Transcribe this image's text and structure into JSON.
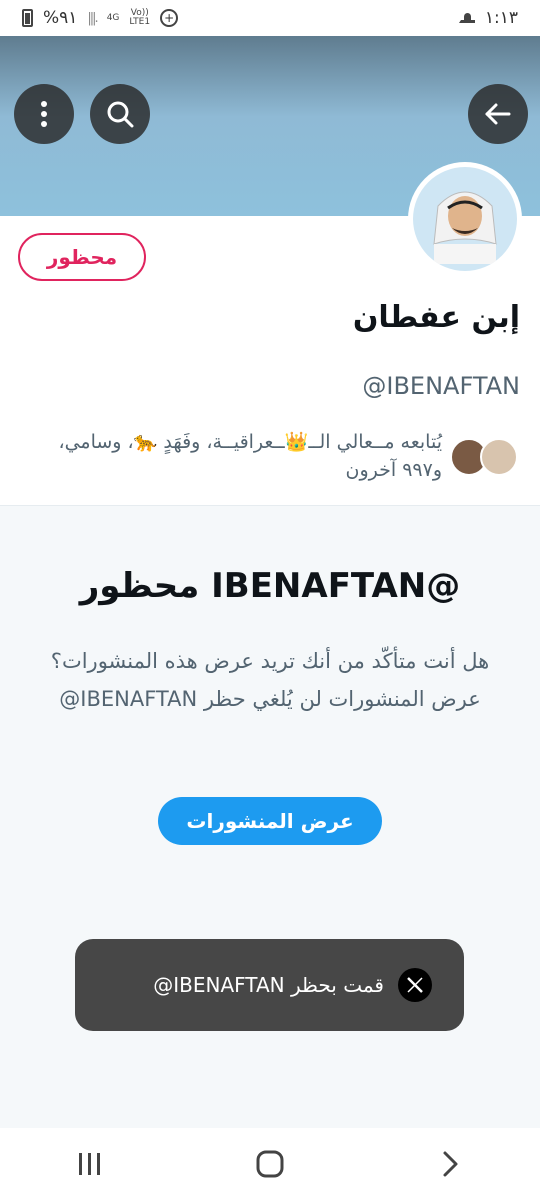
{
  "status_bar": {
    "battery_percent": "%٩١",
    "network_4g": "4G",
    "volte": "Vo))",
    "lte": "LTE1",
    "time": "١:١٣",
    "battery-icon": "battery-icon",
    "signal-icon": "signal-icon",
    "sync-icon": "plus-circle-icon"
  },
  "header": {
    "more_icon": "more-vertical-icon",
    "search_icon": "search-icon",
    "back_icon": "arrow-back-icon"
  },
  "profile": {
    "blocked_label": "محظور",
    "display_name": "إبن عفطان",
    "handle": "@IBENAFTAN",
    "followers_text": "يُتابعه مــعالي الــ👑ــعراقيــة، وفَهَدٍ 🐆، وسامي، و٩٩٧ آخرون"
  },
  "blocked_section": {
    "title": "@IBENAFTAN محظور",
    "description": "هل أنت متأكّد من أنك تريد عرض هذه المنشورات؟ عرض المنشورات لن يُلغي حظر IBENAFTAN@",
    "view_posts_label": "عرض المنشورات"
  },
  "toast": {
    "text": "قمت بحظر IBENAFTAN@",
    "logo": "x-logo-icon"
  },
  "nav_bar": {
    "recents_icon": "recents-icon",
    "home_icon": "home-icon",
    "back_icon": "back-chevron-icon"
  },
  "colors": {
    "accent": "#1d9bf0",
    "blocked_red": "#e0245e",
    "toast_bg": "#474747"
  }
}
